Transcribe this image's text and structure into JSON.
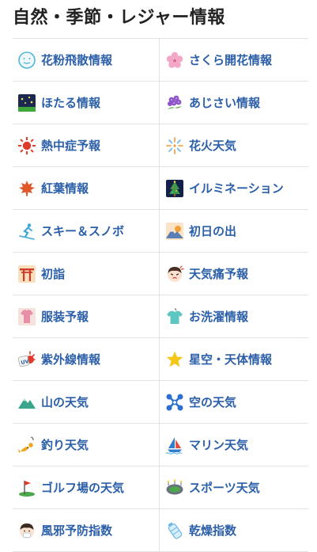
{
  "page": {
    "title": "自然・季節・レジャー情報"
  },
  "items": [
    {
      "label": "花粉飛散情報",
      "icon": "pollen-face-icon"
    },
    {
      "label": "さくら開花情報",
      "icon": "sakura-icon"
    },
    {
      "label": "ほたる情報",
      "icon": "firefly-icon"
    },
    {
      "label": "あじさい情報",
      "icon": "hydrangea-icon"
    },
    {
      "label": "熱中症予報",
      "icon": "sun-heat-icon"
    },
    {
      "label": "花火天気",
      "icon": "fireworks-icon"
    },
    {
      "label": "紅葉情報",
      "icon": "maple-leaf-icon"
    },
    {
      "label": "イルミネーション",
      "icon": "illumination-tree-icon"
    },
    {
      "label": "スキー＆スノボ",
      "icon": "skier-icon"
    },
    {
      "label": "初日の出",
      "icon": "sunrise-icon"
    },
    {
      "label": "初詣",
      "icon": "torii-icon"
    },
    {
      "label": "天気痛予報",
      "icon": "headache-face-icon"
    },
    {
      "label": "服装予報",
      "icon": "clothing-icon"
    },
    {
      "label": "お洗濯情報",
      "icon": "laundry-shirt-icon"
    },
    {
      "label": "紫外線情報",
      "icon": "uv-icon"
    },
    {
      "label": "星空・天体情報",
      "icon": "star-icon"
    },
    {
      "label": "山の天気",
      "icon": "mountain-icon"
    },
    {
      "label": "空の天気",
      "icon": "airplane-icon"
    },
    {
      "label": "釣り天気",
      "icon": "fish-icon"
    },
    {
      "label": "マリン天気",
      "icon": "sailboat-icon"
    },
    {
      "label": "ゴルフ場の天気",
      "icon": "golf-flag-icon"
    },
    {
      "label": "スポーツ天気",
      "icon": "stadium-icon"
    },
    {
      "label": "風邪予防指数",
      "icon": "cold-face-icon"
    },
    {
      "label": "乾燥指数",
      "icon": "bottle-icon"
    }
  ]
}
